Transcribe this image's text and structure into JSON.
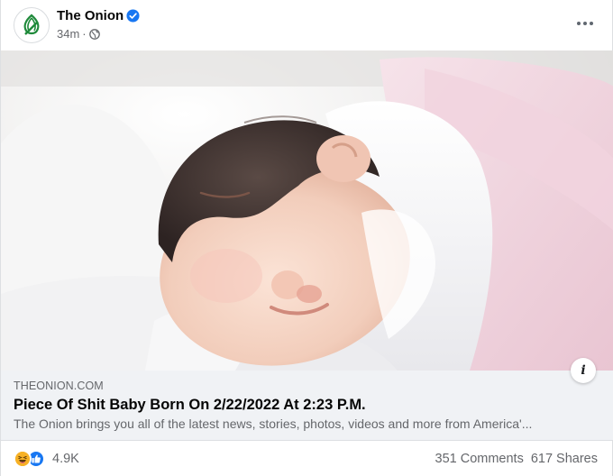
{
  "post": {
    "page_name": "The Onion",
    "time": "34m",
    "separator": "·",
    "visibility_icon": "globe-icon",
    "more_icon": "more-options-icon"
  },
  "photo": {
    "subject_icon": "photo"
  },
  "link": {
    "domain": "THEONION.COM",
    "headline": "Piece Of Shit Baby Born On 2/22/2022 At 2:23 P.M.",
    "description": "The Onion brings you all of the latest news, stories, photos, videos and more from America'...",
    "info_label": "i"
  },
  "footer": {
    "reaction_count": "4.9K",
    "comments": "351 Comments",
    "shares": "617 Shares"
  },
  "colors": {
    "brand_green": "#1f8a3b",
    "link_bg": "#f0f2f5",
    "secondary_text": "#65676b",
    "verified_blue": "#1877f2"
  }
}
